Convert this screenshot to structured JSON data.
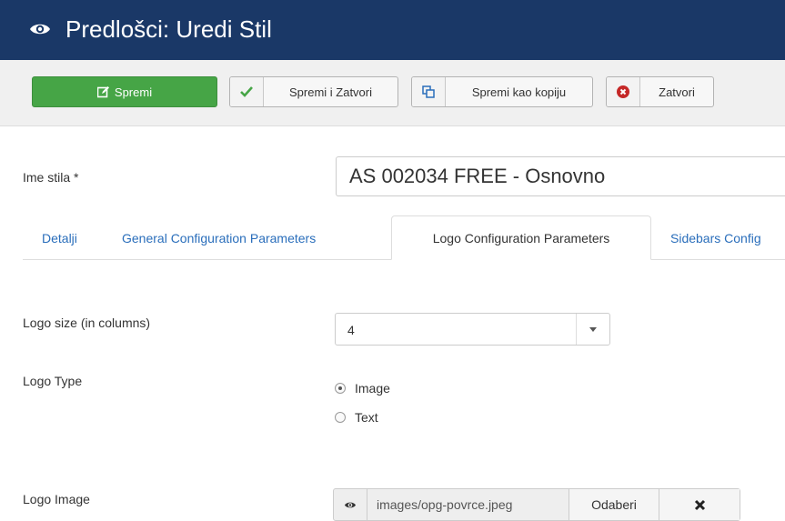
{
  "header": {
    "title": "Predlošci: Uredi Stil",
    "icon": "eye-icon"
  },
  "toolbar": {
    "save_label": "Spremi",
    "save_close_label": "Spremi i Zatvori",
    "save_copy_label": "Spremi kao kopiju",
    "close_label": "Zatvori"
  },
  "colors": {
    "header_bg": "#1a3867",
    "save_green": "#46a546",
    "link_blue": "#2a6ebb",
    "close_red": "#c52827"
  },
  "form": {
    "name_label": "Ime stila *",
    "name_value": "AS 002034 FREE - Osnovno"
  },
  "tabs": [
    {
      "label": "Detalji",
      "active": false
    },
    {
      "label": "General Configuration Parameters",
      "active": false
    },
    {
      "label": "Logo Configuration Parameters",
      "active": true
    },
    {
      "label": "Sidebars Config",
      "active": false
    }
  ],
  "logo": {
    "size_label": "Logo size (in columns)",
    "size_value": "4",
    "type_label": "Logo Type",
    "type_options": [
      {
        "label": "Image",
        "checked": true
      },
      {
        "label": "Text",
        "checked": false
      }
    ],
    "image_label": "Logo Image",
    "image_path": "images/opg-povrce.jpeg",
    "select_label": "Odaberi",
    "clear_icon": "close-icon"
  }
}
